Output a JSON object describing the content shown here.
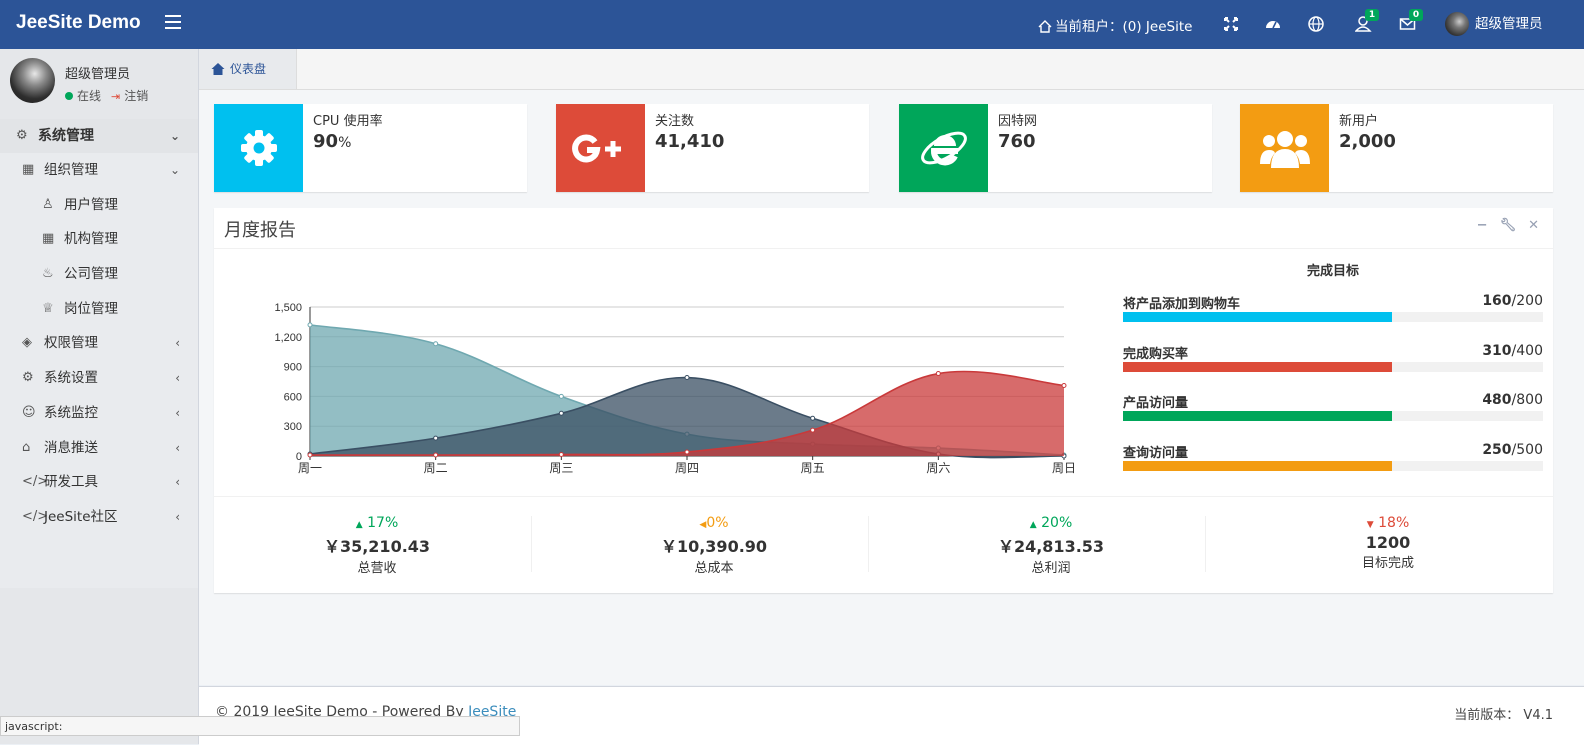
{
  "header": {
    "logo": "JeeSite Demo",
    "tenant": "当前租户：(0) JeeSite",
    "notify_badge": "1",
    "mail_badge": "0",
    "user_name": "超级管理员"
  },
  "sidebar": {
    "user_name": "超级管理员",
    "status_online": "在线",
    "logout": "注销",
    "menu": [
      {
        "label": "系统管理",
        "icon": "gear-icon"
      },
      {
        "label": "组织管理",
        "icon": "grid-icon"
      },
      {
        "label": "用户管理",
        "icon": "user-icon"
      },
      {
        "label": "机构管理",
        "icon": "grid-icon"
      },
      {
        "label": "公司管理",
        "icon": "fire-icon"
      },
      {
        "label": "岗位管理",
        "icon": "trophy-icon"
      },
      {
        "label": "权限管理",
        "icon": "layers-icon"
      },
      {
        "label": "系统设置",
        "icon": "gear-icon"
      },
      {
        "label": "系统监控",
        "icon": "ghost-icon"
      },
      {
        "label": "消息推送",
        "icon": "inbox-icon"
      },
      {
        "label": "研发工具",
        "icon": "code-icon"
      },
      {
        "label": "JeeSite社区",
        "icon": "code-icon"
      }
    ]
  },
  "tabs": {
    "dashboard": "仪表盘"
  },
  "infoboxes": [
    {
      "label": "CPU 使用率",
      "value": "90",
      "unit": "%",
      "color": "#00c0ef",
      "icon": "gear-icon"
    },
    {
      "label": "关注数",
      "value": "41,410",
      "unit": "",
      "color": "#dd4b39",
      "icon": "google-plus-icon"
    },
    {
      "label": "因特网",
      "value": "760",
      "unit": "",
      "color": "#00a65a",
      "icon": "internet-explorer-icon"
    },
    {
      "label": "新用户",
      "value": "2,000",
      "unit": "",
      "color": "#f39c12",
      "icon": "users-icon"
    }
  ],
  "report": {
    "title": "月度报告",
    "goals_title": "完成目标",
    "goals": [
      {
        "label": "将产品添加到购物车",
        "done": "160",
        "total": "/200",
        "fraction": 0.8,
        "color": "#00c0ef"
      },
      {
        "label": "完成购买率",
        "done": "310",
        "total": "/400",
        "fraction": 0.8,
        "color": "#dd4b39"
      },
      {
        "label": "产品访问量",
        "done": "480",
        "total": "/800",
        "fraction": 0.8,
        "color": "#00a65a"
      },
      {
        "label": "查询访问量",
        "done": "250",
        "total": "/500",
        "fraction": 0.8,
        "color": "#f39c12"
      }
    ],
    "descriptions": [
      {
        "pct": "17%",
        "dir": "up",
        "color": "#00a65a",
        "amount": "￥35,210.43",
        "label": "总营收"
      },
      {
        "pct": "0%",
        "dir": "left",
        "color": "#f39c12",
        "amount": "￥10,390.90",
        "label": "总成本"
      },
      {
        "pct": "20%",
        "dir": "up",
        "color": "#00a65a",
        "amount": "￥24,813.53",
        "label": "总利润"
      },
      {
        "pct": "18%",
        "dir": "down",
        "color": "#dd4b39",
        "amount": "1200",
        "label": "目标完成"
      }
    ]
  },
  "chart_data": {
    "type": "area",
    "categories": [
      "周一",
      "周二",
      "周三",
      "周四",
      "周五",
      "周六",
      "周日"
    ],
    "ylim": [
      0,
      1500
    ],
    "yticks": [
      "0",
      "300",
      "600",
      "900",
      "1,200",
      "1,500"
    ],
    "grid": true,
    "series": [
      {
        "color": "#6fa8b0",
        "values": [
          1320,
          1130,
          600,
          220,
          120,
          80,
          10
        ]
      },
      {
        "color": "#3a4f63",
        "values": [
          20,
          180,
          430,
          790,
          380,
          20,
          0
        ]
      },
      {
        "color": "#c9393a",
        "values": [
          10,
          10,
          15,
          40,
          260,
          830,
          710
        ]
      }
    ]
  },
  "footer": {
    "copyright": "© 2019 JeeSite Demo - Powered By ",
    "link": "JeeSite",
    "version": "当前版本： V4.1"
  },
  "statusbar": "javascript:"
}
